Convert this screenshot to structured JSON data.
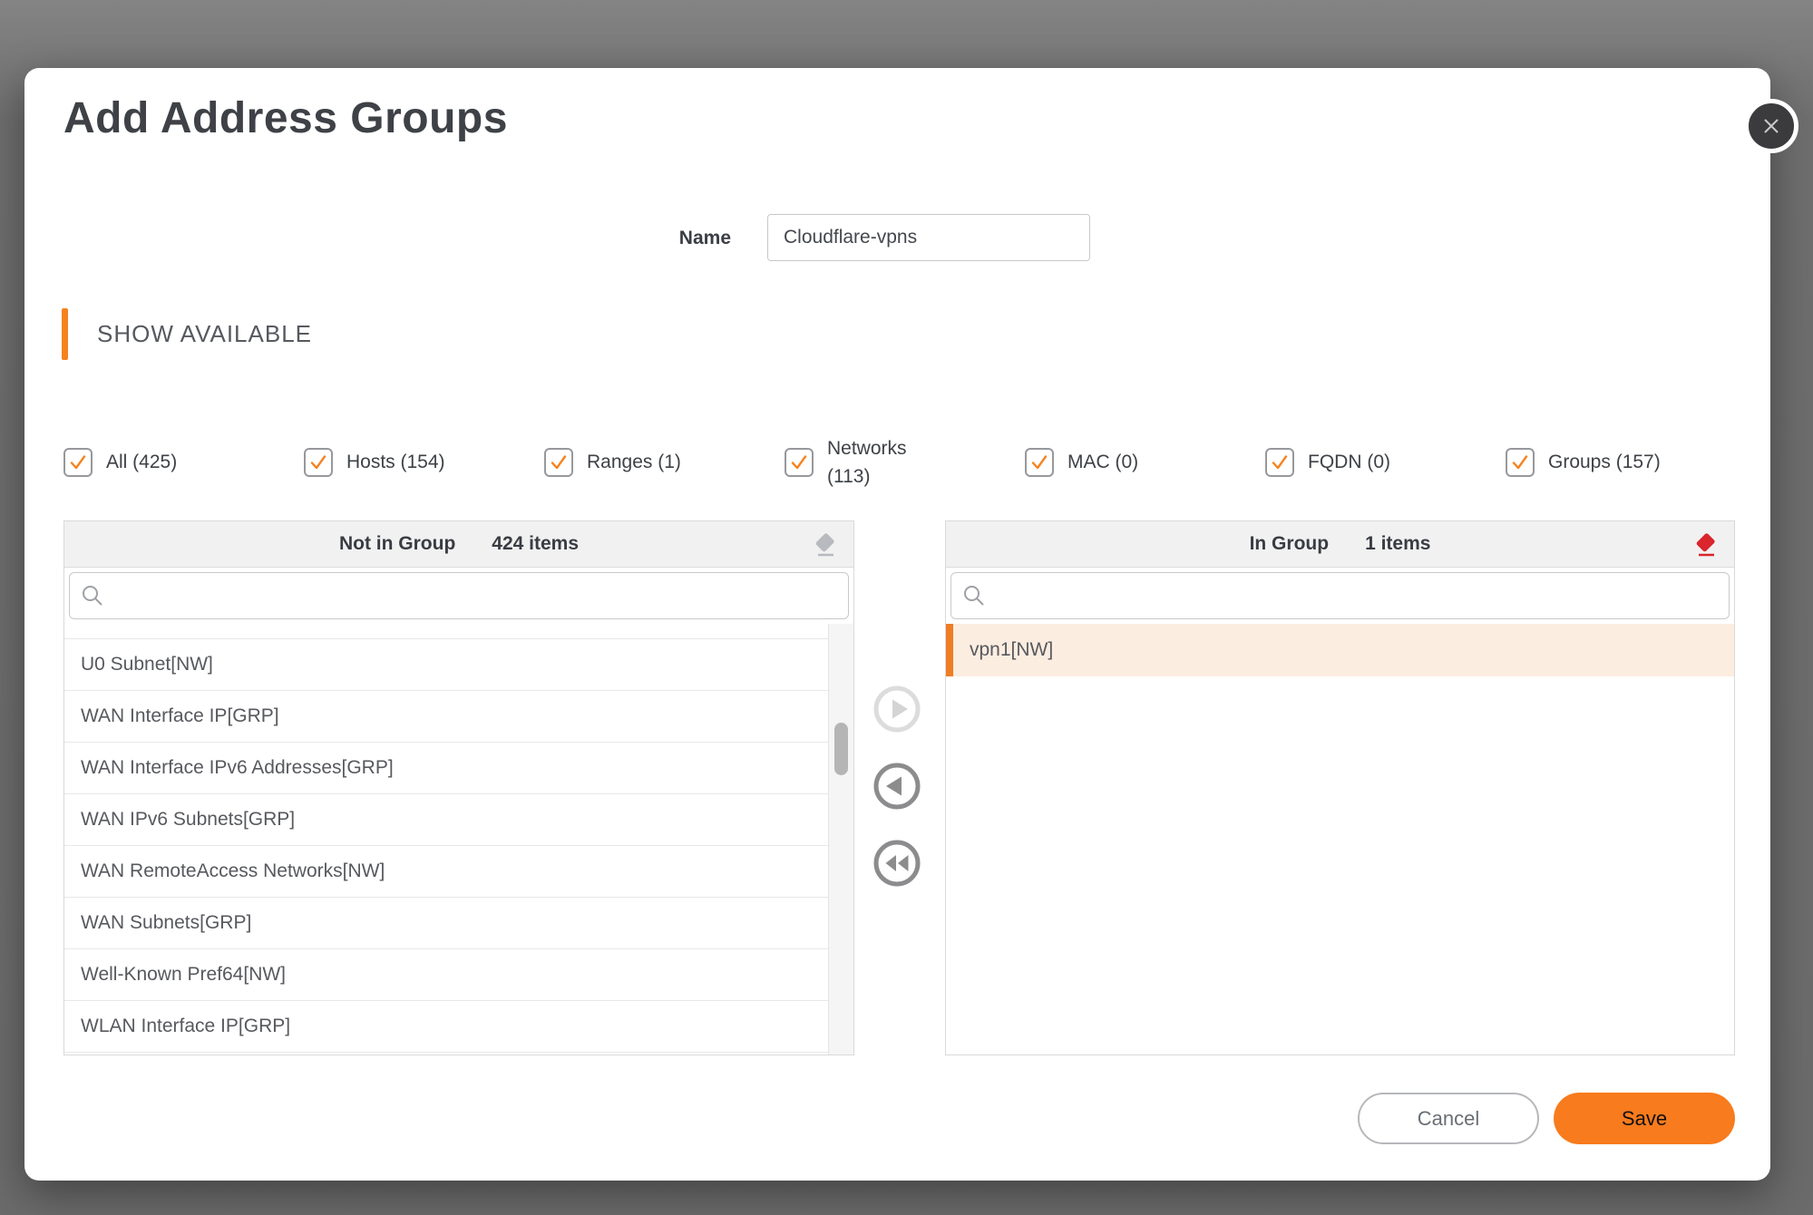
{
  "modal": {
    "title": "Add Address Groups"
  },
  "name_field": {
    "label": "Name",
    "value": "Cloudflare-vpns"
  },
  "section_header": {
    "label": "SHOW AVAILABLE"
  },
  "filters": [
    {
      "label": "All (425)",
      "checked": true
    },
    {
      "label": "Hosts (154)",
      "checked": true
    },
    {
      "label": "Ranges (1)",
      "checked": true
    },
    {
      "label": "Networks\n(113)",
      "checked": true
    },
    {
      "label": "MAC (0)",
      "checked": true
    },
    {
      "label": "FQDN (0)",
      "checked": true
    },
    {
      "label": "Groups (157)",
      "checked": true
    }
  ],
  "not_in_group": {
    "title": "Not in Group",
    "count": "424 items",
    "items": [
      "U0 Subnet[NW]",
      "WAN Interface IP[GRP]",
      "WAN Interface IPv6 Addresses[GRP]",
      "WAN IPv6 Subnets[GRP]",
      "WAN RemoteAccess Networks[NW]",
      "WAN Subnets[GRP]",
      "Well-Known Pref64[NW]",
      "WLAN Interface IP[GRP]"
    ]
  },
  "in_group": {
    "title": "In Group",
    "count": "1 items",
    "items": [
      "vpn1[NW]"
    ]
  },
  "actions": {
    "cancel": "Cancel",
    "save": "Save"
  },
  "colors": {
    "accent_orange": "#F5821F",
    "save_orange": "#F87B1D",
    "selected_row_bg": "#FBEDE0",
    "selected_row_bar": "#EF7D26",
    "eraser_red": "#D9252B",
    "eraser_gray": "#B7BABF",
    "backdrop": "#6B6B6B"
  }
}
